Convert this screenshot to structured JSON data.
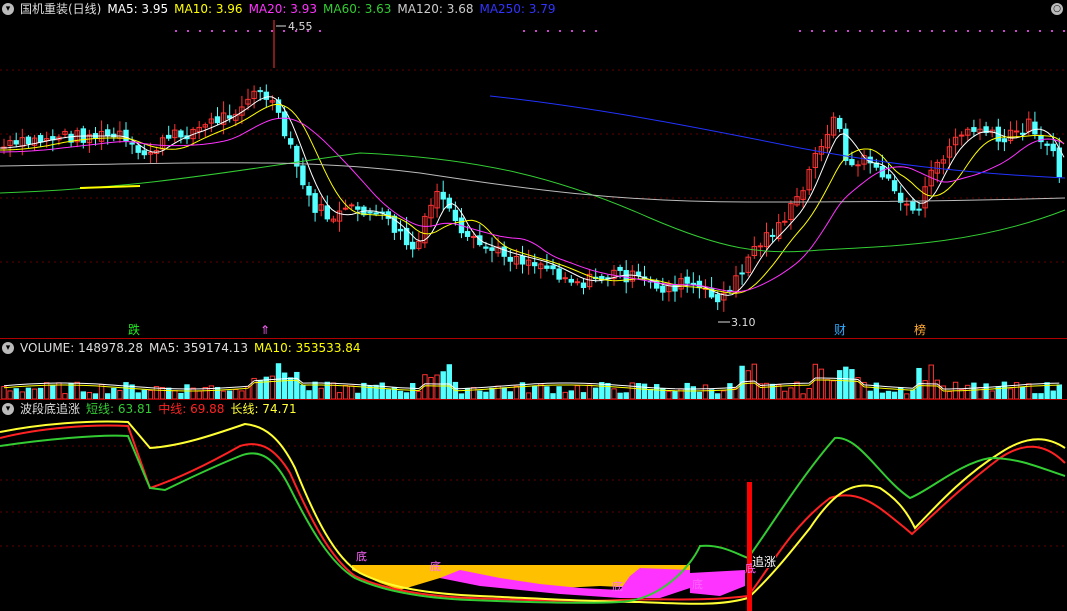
{
  "main_header": {
    "title": "国机重装(日线)",
    "ma": [
      {
        "label": "MA5: 3.95",
        "color": "#ffffff"
      },
      {
        "label": "MA10: 3.96",
        "color": "#ffff00"
      },
      {
        "label": "MA20: 3.93",
        "color": "#ff33ff"
      },
      {
        "label": "MA60: 3.63",
        "color": "#33cc33"
      },
      {
        "label": "MA120: 3.68",
        "color": "#cccccc"
      },
      {
        "label": "MA250: 3.79",
        "color": "#3333ff"
      }
    ]
  },
  "price_high_label": "4.55",
  "price_low_label": "3.10",
  "tags": {
    "die": "跌",
    "cai": "财",
    "bang": "榜",
    "zhuizhang": "追涨",
    "di": "底"
  },
  "volume_header": {
    "title": "VOLUME: 148978.28",
    "ma5": "MA5: 359174.13",
    "ma10": "MA10: 353533.84"
  },
  "indicator_header": {
    "title": "波段底追涨",
    "short": "短线: 63.81",
    "mid": "中线: 69.88",
    "long": "长线: 74.71"
  },
  "colors": {
    "up": "#ff3333",
    "down": "#54ffff",
    "short": "#33cc33",
    "mid": "#ff2222",
    "long": "#ffff33",
    "fill_gold": "#ffc000",
    "fill_magenta": "#ff33ff"
  },
  "chart_data": [
    {
      "type": "candlestick",
      "title": "国机重装(日线)",
      "price_range": [
        3.1,
        4.55
      ],
      "series": [
        {
          "name": "MA5",
          "last": 3.95
        },
        {
          "name": "MA10",
          "last": 3.96
        },
        {
          "name": "MA20",
          "last": 3.93
        },
        {
          "name": "MA60",
          "last": 3.63
        },
        {
          "name": "MA120",
          "last": 3.68
        },
        {
          "name": "MA250",
          "last": 3.79
        }
      ]
    },
    {
      "type": "bar",
      "title": "VOLUME",
      "last": 148978.28,
      "series": [
        {
          "name": "MA5",
          "last": 359174.13
        },
        {
          "name": "MA10",
          "last": 353533.84
        }
      ]
    },
    {
      "type": "line",
      "title": "波段底追涨",
      "series": [
        {
          "name": "短线",
          "last": 63.81
        },
        {
          "name": "中线",
          "last": 69.88
        },
        {
          "name": "长线",
          "last": 74.71
        }
      ]
    }
  ]
}
